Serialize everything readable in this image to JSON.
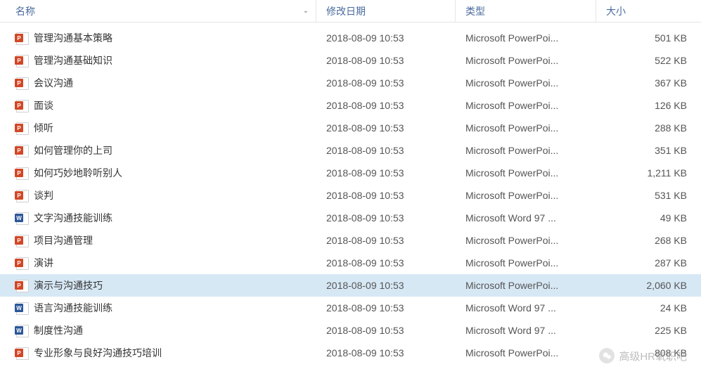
{
  "columns": {
    "name": "名称",
    "date": "修改日期",
    "type": "类型",
    "size": "大小"
  },
  "files": [
    {
      "name": "管理沟通基本策略",
      "date": "2018-08-09 10:53",
      "type": "Microsoft PowerPoi...",
      "size": "501 KB",
      "icon": "ppt",
      "selected": false
    },
    {
      "name": "管理沟通基础知识",
      "date": "2018-08-09 10:53",
      "type": "Microsoft PowerPoi...",
      "size": "522 KB",
      "icon": "ppt",
      "selected": false
    },
    {
      "name": "会议沟通",
      "date": "2018-08-09 10:53",
      "type": "Microsoft PowerPoi...",
      "size": "367 KB",
      "icon": "ppt",
      "selected": false
    },
    {
      "name": "面谈",
      "date": "2018-08-09 10:53",
      "type": "Microsoft PowerPoi...",
      "size": "126 KB",
      "icon": "ppt",
      "selected": false
    },
    {
      "name": "倾听",
      "date": "2018-08-09 10:53",
      "type": "Microsoft PowerPoi...",
      "size": "288 KB",
      "icon": "ppt",
      "selected": false
    },
    {
      "name": "如何管理你的上司",
      "date": "2018-08-09 10:53",
      "type": "Microsoft PowerPoi...",
      "size": "351 KB",
      "icon": "ppt",
      "selected": false
    },
    {
      "name": "如何巧妙地聆听别人",
      "date": "2018-08-09 10:53",
      "type": "Microsoft PowerPoi...",
      "size": "1,211 KB",
      "icon": "ppt",
      "selected": false
    },
    {
      "name": "谈判",
      "date": "2018-08-09 10:53",
      "type": "Microsoft PowerPoi...",
      "size": "531 KB",
      "icon": "ppt",
      "selected": false
    },
    {
      "name": "文字沟通技能训练",
      "date": "2018-08-09 10:53",
      "type": "Microsoft Word 97 ...",
      "size": "49 KB",
      "icon": "doc",
      "selected": false
    },
    {
      "name": "项目沟通管理",
      "date": "2018-08-09 10:53",
      "type": "Microsoft PowerPoi...",
      "size": "268 KB",
      "icon": "ppt",
      "selected": false
    },
    {
      "name": "演讲",
      "date": "2018-08-09 10:53",
      "type": "Microsoft PowerPoi...",
      "size": "287 KB",
      "icon": "ppt",
      "selected": false
    },
    {
      "name": "演示与沟通技巧",
      "date": "2018-08-09 10:53",
      "type": "Microsoft PowerPoi...",
      "size": "2,060 KB",
      "icon": "ppt",
      "selected": true
    },
    {
      "name": "语言沟通技能训练",
      "date": "2018-08-09 10:53",
      "type": "Microsoft Word 97 ...",
      "size": "24 KB",
      "icon": "doc",
      "selected": false
    },
    {
      "name": "制度性沟通",
      "date": "2018-08-09 10:53",
      "type": "Microsoft Word 97 ...",
      "size": "225 KB",
      "icon": "doc",
      "selected": false
    },
    {
      "name": "专业形象与良好沟通技巧培训",
      "date": "2018-08-09 10:53",
      "type": "Microsoft PowerPoi...",
      "size": "808 KB",
      "icon": "ppt",
      "selected": false
    }
  ],
  "watermark": {
    "text": "高级HR氧职吧"
  }
}
